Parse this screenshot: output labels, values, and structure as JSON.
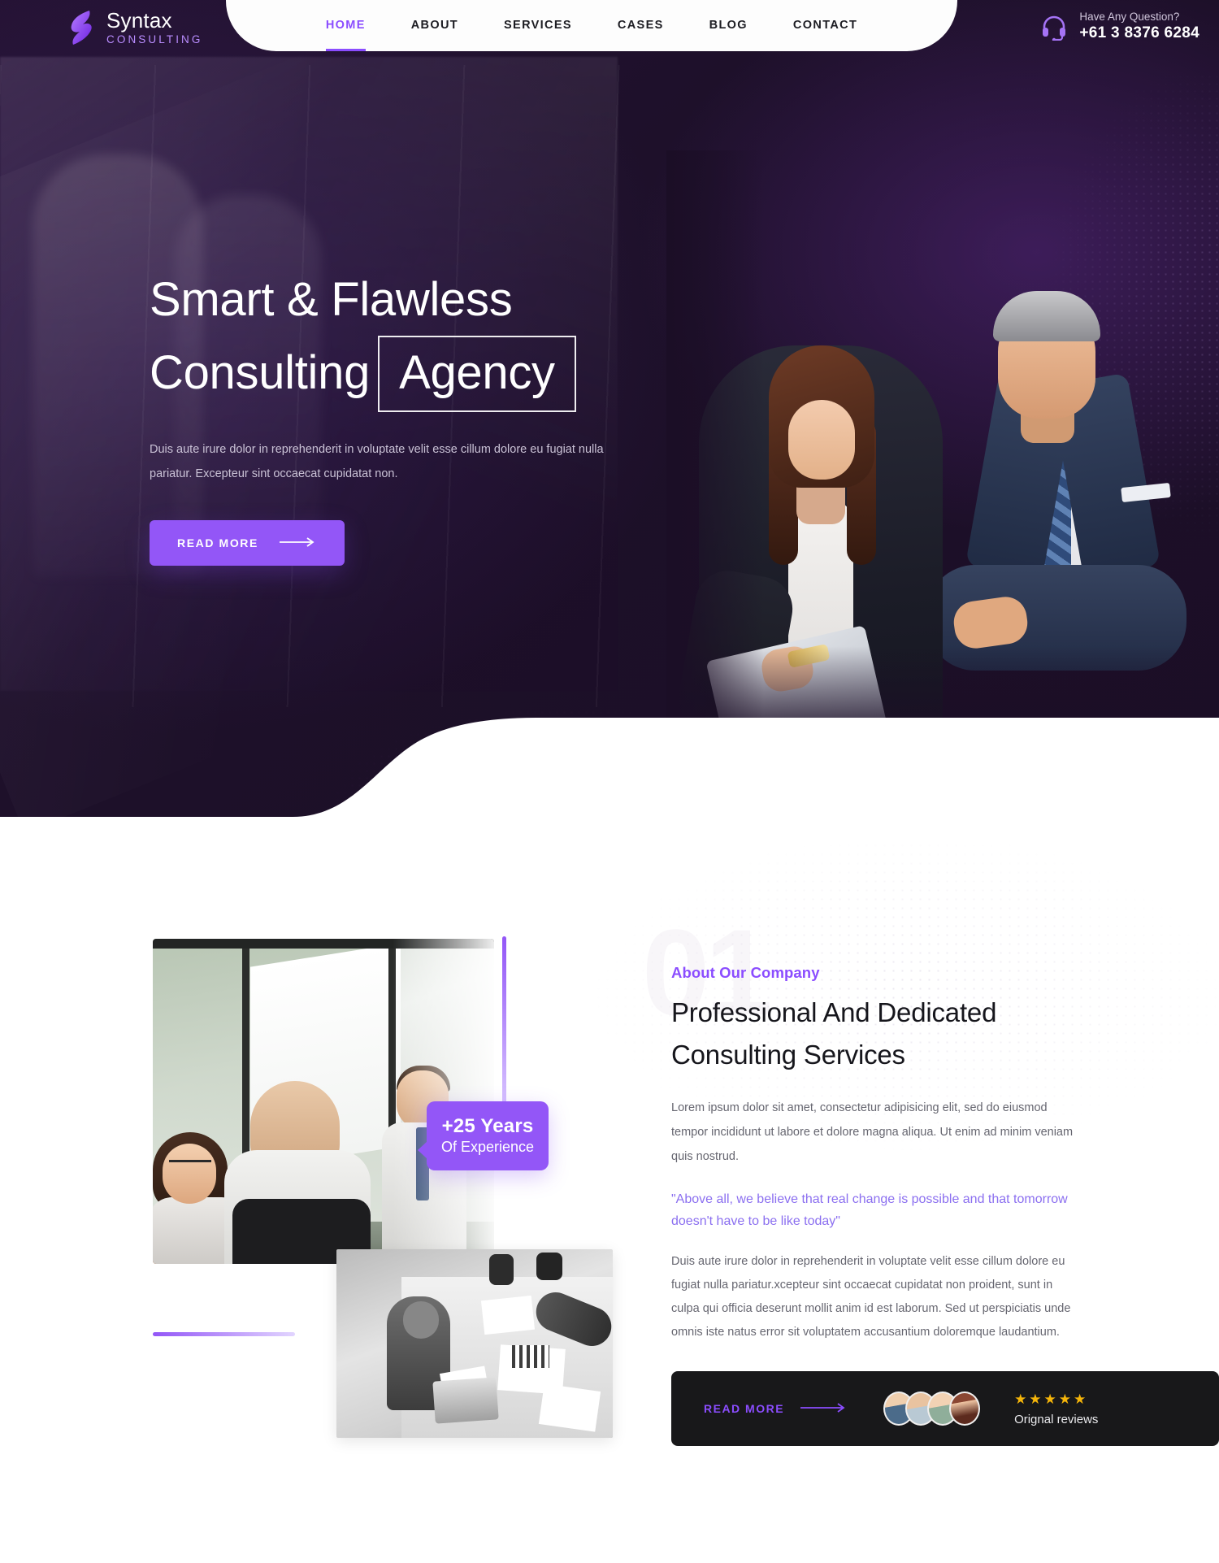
{
  "brand": {
    "name": "Syntax",
    "tagline": "CONSULTING",
    "logo_icon": "syntax-s-logo"
  },
  "nav": {
    "items": [
      {
        "label": "HOME",
        "active": true
      },
      {
        "label": "ABOUT",
        "active": false
      },
      {
        "label": "SERVICES",
        "active": false
      },
      {
        "label": "CASES",
        "active": false
      },
      {
        "label": "BLOG",
        "active": false
      },
      {
        "label": "CONTACT",
        "active": false
      }
    ]
  },
  "contact": {
    "icon": "headset-icon",
    "question": "Have Any Question?",
    "phone": "+61 3 8376 6284"
  },
  "hero": {
    "title_line1": "Smart & Flawless",
    "title_line2": "Consulting",
    "title_highlight": "Agency",
    "description": "Duis aute irure dolor in reprehenderit in voluptate velit esse cillum dolore eu fugiat nulla pariatur. Excepteur sint occaecat cupidatat non.",
    "cta_label": "READ MORE"
  },
  "about": {
    "watermark": "01",
    "eyebrow": "About Our Company",
    "heading_line1": "Professional And Dedicated",
    "heading_line2": "Consulting Services",
    "paragraph1": "Lorem ipsum dolor sit amet, consectetur adipisicing elit, sed do eiusmod tempor incididunt ut labore et dolore magna aliqua. Ut enim ad minim veniam quis nostrud.",
    "quote": "\"Above all, we believe that real change is possible and that tomorrow doesn't have to be like today\"",
    "paragraph2": "Duis aute irure dolor in reprehenderit in voluptate velit esse cillum dolore eu fugiat nulla pariatur.xcepteur sint occaecat cupidatat non proident, sunt in culpa qui officia deserunt mollit anim id est laborum. Sed ut perspiciatis unde omnis iste natus error sit voluptatem accusantium doloremque laudantium.",
    "badge": {
      "years": "+25 Years",
      "subtitle": "Of Experience"
    },
    "review_card": {
      "cta_label": "READ MORE",
      "stars": "★★★★★",
      "rating_label": "Orignal reviews",
      "avatar_count": 4
    }
  },
  "colors": {
    "brand_purple": "#9356f7",
    "accent_purple": "#8b4dff",
    "hero_dark": "#1b0e26",
    "star_gold": "#f5b50a",
    "card_dark": "#18181a"
  }
}
